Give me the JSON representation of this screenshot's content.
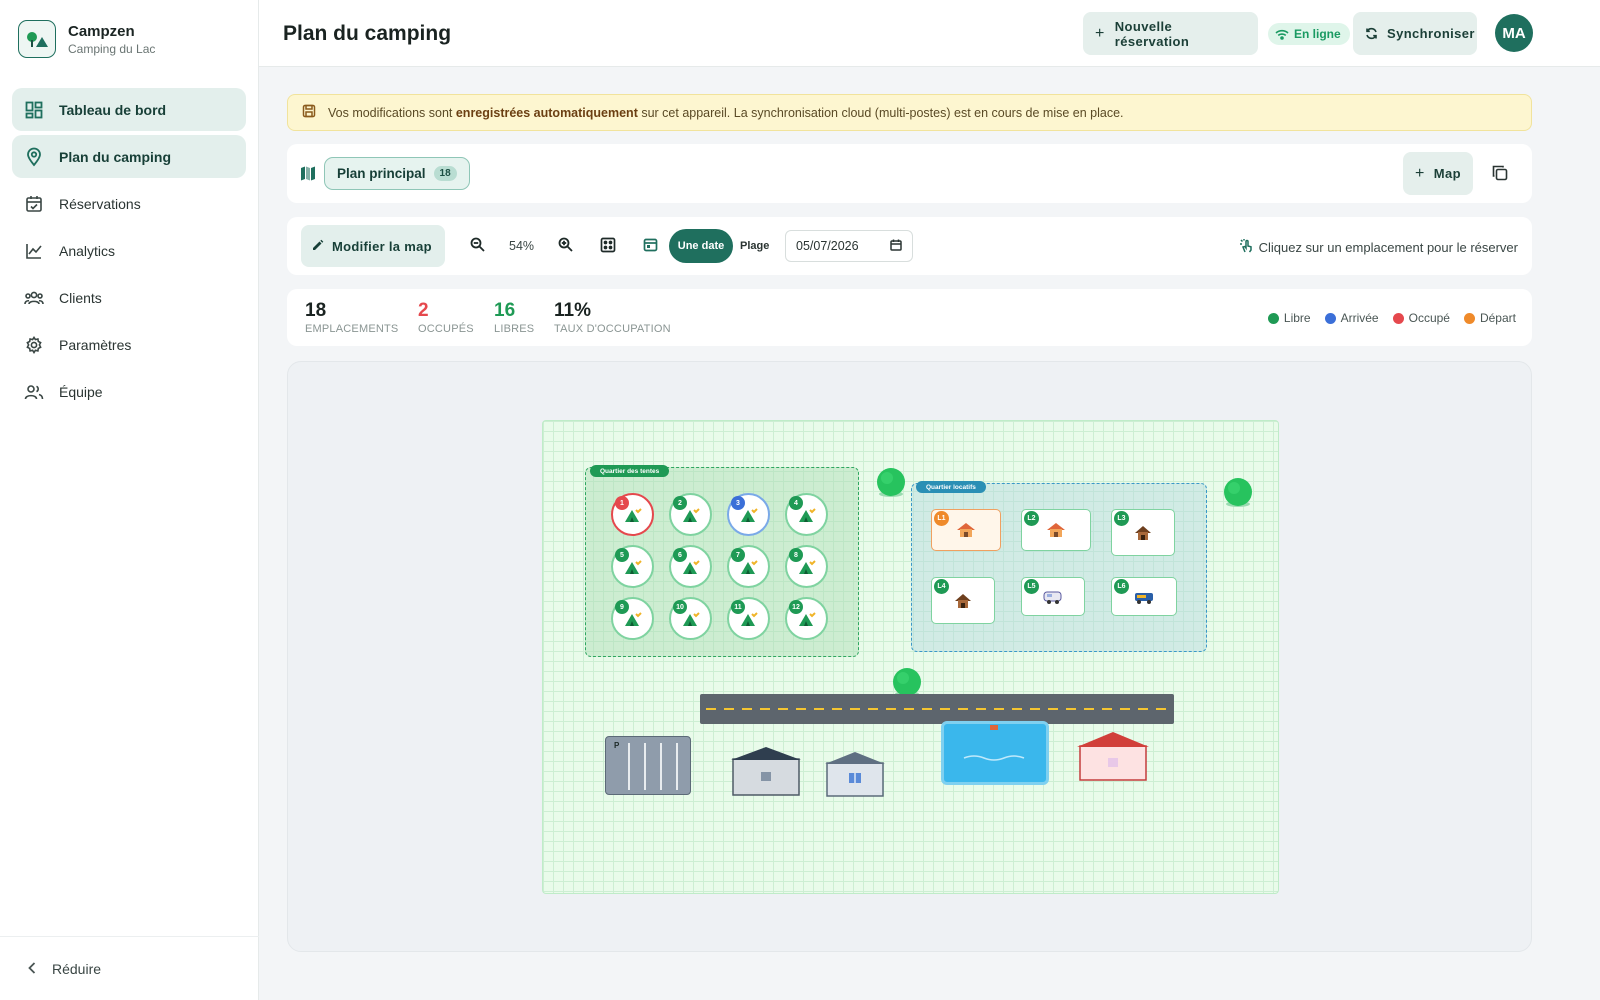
{
  "brand": {
    "name": "Campzen",
    "subtitle": "Camping du Lac"
  },
  "nav": [
    {
      "label": "Tableau de bord",
      "icon": "dashboard-icon",
      "active": true
    },
    {
      "label": "Plan du camping",
      "icon": "map-pin-icon",
      "active": true
    },
    {
      "label": "Réservations",
      "icon": "calendar-icon",
      "active": false
    },
    {
      "label": "Analytics",
      "icon": "chart-icon",
      "active": false
    },
    {
      "label": "Clients",
      "icon": "people-icon",
      "active": false
    },
    {
      "label": "Paramètres",
      "icon": "gear-icon",
      "active": false
    },
    {
      "label": "Équipe",
      "icon": "team-icon",
      "active": false
    }
  ],
  "sidebar_footer": {
    "label": "Réduire"
  },
  "header": {
    "title": "Plan du camping",
    "new_booking": "Nouvelle réservation",
    "status": "En ligne",
    "sync": "Synchroniser",
    "avatar": "MA"
  },
  "banner": {
    "prefix": "Vos modifications sont",
    "bold": "enregistrées automatiquement",
    "suffix": "sur cet appareil. La synchronisation cloud (multi-postes) est en cours de mise en place."
  },
  "maps": {
    "chip_label": "Plan principal",
    "chip_count": "18",
    "add_label": "Map"
  },
  "toolbar": {
    "edit_label": "Modifier la map",
    "zoom": "54%",
    "mode_single": "Une date",
    "mode_range": "Plage",
    "date": "05/07/2026",
    "hint": "Cliquez sur un emplacement pour le réserver"
  },
  "stats": [
    {
      "value": "18",
      "label": "EMPLACEMENTS",
      "color": "#1a2321"
    },
    {
      "value": "2",
      "label": "OCCUPÉS",
      "color": "#e5484d"
    },
    {
      "value": "16",
      "label": "LIBRES",
      "color": "#1f9a55"
    },
    {
      "value": "11%",
      "label": "TAUX D'OCCUPATION",
      "color": "#1a2321"
    }
  ],
  "legend": [
    {
      "label": "Libre",
      "color": "#1f9a55"
    },
    {
      "label": "Arrivée",
      "color": "#3b6fd8"
    },
    {
      "label": "Occupé",
      "color": "#e5484d"
    },
    {
      "label": "Départ",
      "color": "#ef8a2a"
    }
  ],
  "map": {
    "zone_tents": "Quartier des tentes",
    "zone_rentals": "Quartier locatifs",
    "parking_label": "P",
    "pitches": [
      {
        "id": "1",
        "status": "occupied"
      },
      {
        "id": "2",
        "status": "free"
      },
      {
        "id": "3",
        "status": "arrival"
      },
      {
        "id": "4",
        "status": "free"
      },
      {
        "id": "5",
        "status": "free"
      },
      {
        "id": "6",
        "status": "free"
      },
      {
        "id": "7",
        "status": "free"
      },
      {
        "id": "8",
        "status": "free"
      },
      {
        "id": "9",
        "status": "free"
      },
      {
        "id": "10",
        "status": "free"
      },
      {
        "id": "11",
        "status": "free"
      },
      {
        "id": "12",
        "status": "free"
      }
    ],
    "rentals": [
      {
        "id": "L1",
        "status": "departure",
        "icon": "chalet-icon"
      },
      {
        "id": "L2",
        "status": "free",
        "icon": "chalet-icon"
      },
      {
        "id": "L3",
        "status": "free",
        "icon": "hut-icon"
      },
      {
        "id": "L4",
        "status": "free",
        "icon": "hut-icon"
      },
      {
        "id": "L5",
        "status": "free",
        "icon": "caravan-icon"
      },
      {
        "id": "L6",
        "status": "free",
        "icon": "camper-icon"
      }
    ]
  }
}
